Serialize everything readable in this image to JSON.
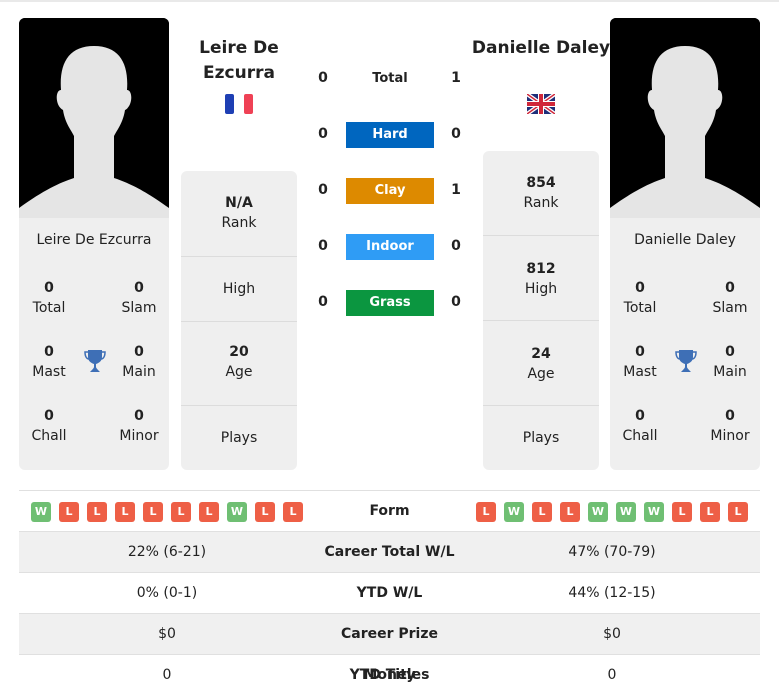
{
  "colors": {
    "hard": "#0066bf",
    "clay": "#dd8a00",
    "indoor": "#2f9cf5",
    "grass": "#0b9640",
    "win": "#6fbf73",
    "loss": "#ee5f46",
    "trophy": "#3e6fb6"
  },
  "player1": {
    "name": "Leire De Ezcurra",
    "flag": "france-flag",
    "photo": "player-silhouette",
    "titles": {
      "total": {
        "value": "0",
        "label": "Total"
      },
      "slam": {
        "value": "0",
        "label": "Slam"
      },
      "mast": {
        "value": "0",
        "label": "Mast"
      },
      "main": {
        "value": "0",
        "label": "Main"
      },
      "chall": {
        "value": "0",
        "label": "Chall"
      },
      "minor": {
        "value": "0",
        "label": "Minor"
      }
    },
    "info": {
      "rank": {
        "value": "N/A",
        "label": "Rank"
      },
      "high": {
        "value": "",
        "label": "High"
      },
      "age": {
        "value": "20",
        "label": "Age"
      },
      "plays": {
        "value": "",
        "label": "Plays"
      }
    },
    "form": [
      "W",
      "L",
      "L",
      "L",
      "L",
      "L",
      "L",
      "W",
      "L",
      "L"
    ],
    "career_total_wl": "22% (6-21)",
    "ytd_wl": "0% (0-1)",
    "career_prize_money": "$0",
    "ytd_titles": "0"
  },
  "player2": {
    "name": "Danielle Daley",
    "flag": "uk-flag",
    "photo": "player-silhouette",
    "titles": {
      "total": {
        "value": "0",
        "label": "Total"
      },
      "slam": {
        "value": "0",
        "label": "Slam"
      },
      "mast": {
        "value": "0",
        "label": "Mast"
      },
      "main": {
        "value": "0",
        "label": "Main"
      },
      "chall": {
        "value": "0",
        "label": "Chall"
      },
      "minor": {
        "value": "0",
        "label": "Minor"
      }
    },
    "info": {
      "rank": {
        "value": "854",
        "label": "Rank"
      },
      "high": {
        "value": "812",
        "label": "High"
      },
      "age": {
        "value": "24",
        "label": "Age"
      },
      "plays": {
        "value": "",
        "label": "Plays"
      }
    },
    "form": [
      "L",
      "W",
      "L",
      "L",
      "W",
      "W",
      "W",
      "L",
      "L",
      "L"
    ],
    "career_total_wl": "47% (70-79)",
    "ytd_wl": "44% (12-15)",
    "career_prize_money": "$0",
    "ytd_titles": "0"
  },
  "h2h": [
    {
      "surface": "Total",
      "p1": "0",
      "p2": "1"
    },
    {
      "surface": "Hard",
      "p1": "0",
      "p2": "0"
    },
    {
      "surface": "Clay",
      "p1": "0",
      "p2": "1"
    },
    {
      "surface": "Indoor",
      "p1": "0",
      "p2": "0"
    },
    {
      "surface": "Grass",
      "p1": "0",
      "p2": "0"
    }
  ],
  "table_labels": {
    "form": "Form",
    "career_total_wl": "Career Total W/L",
    "ytd_wl": "YTD W/L",
    "career_prize_money": "Career Prize Money",
    "ytd_titles": "YTD Titles"
  }
}
